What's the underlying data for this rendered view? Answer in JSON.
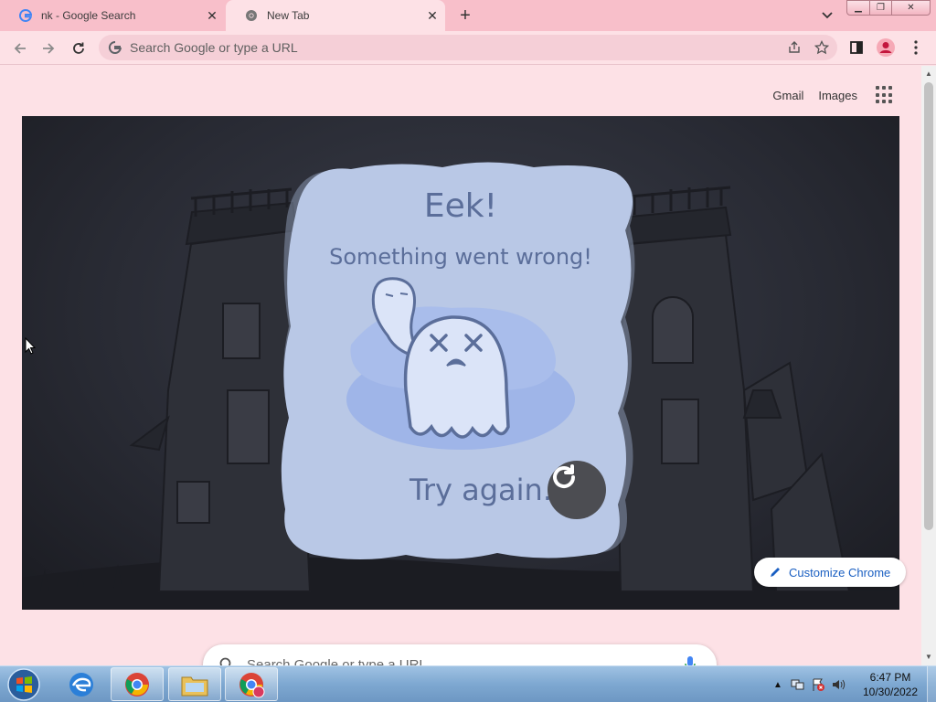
{
  "tabs": [
    {
      "title": "nk - Google Search",
      "favicon": "google-g-icon",
      "active": false
    },
    {
      "title": "New Tab",
      "favicon": "chrome-icon",
      "active": true
    }
  ],
  "toolbar": {
    "omnibox_placeholder": "Search Google or type a URL"
  },
  "ntp": {
    "links": {
      "gmail": "Gmail",
      "images": "Images"
    },
    "doodle": {
      "headline": "Eek!",
      "message": "Something went wrong!",
      "try_again": "Try again."
    },
    "customize_label": "Customize Chrome",
    "search_placeholder": "Search Google or type a URL"
  },
  "taskbar": {
    "time": "6:47 PM",
    "date": "10/30/2022"
  },
  "colors": {
    "tabstrip": "#f8bfca",
    "page_bg": "#fde1e6",
    "card": "#b9c8e6",
    "card_text": "#5b6e9a",
    "accent": "#1a5fc2"
  }
}
